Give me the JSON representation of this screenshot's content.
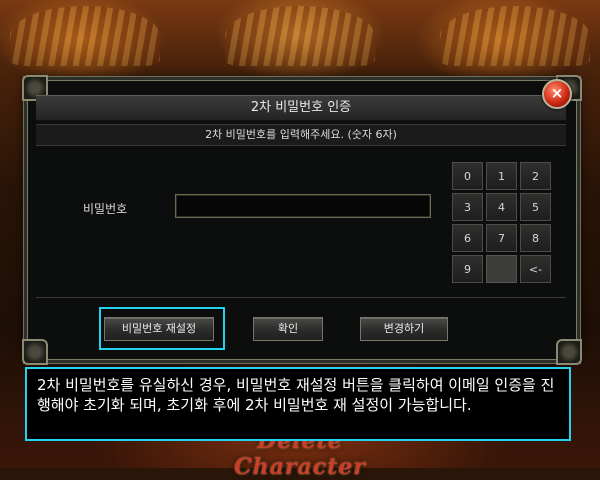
{
  "dialog": {
    "title": "2차 비밀번호 인증",
    "close_icon": "×",
    "instruction": "2차 비밀번호를 입력해주세요. (숫자 6자)",
    "password_label": "비밀번호",
    "password_value": "",
    "keypad": {
      "keys": [
        "0",
        "1",
        "2",
        "3",
        "4",
        "5",
        "6",
        "7",
        "8",
        "9",
        "",
        "<-"
      ]
    },
    "buttons": {
      "reset": "비밀번호 재설정",
      "confirm": "확인",
      "change": "변경하기"
    }
  },
  "tooltip": {
    "text": "2차 비밀번호를 유실하신 경우, 비밀번호 재설정 버튼을 클릭하여 이메일 인증을 진행해야 초기화 되며, 초기화 후에 2차 비밀번호 재 설정이 가능합니다."
  },
  "background": {
    "decor_text": "Delete Character"
  },
  "colors": {
    "highlight": "#24d2f0",
    "close_button": "#d02a12"
  }
}
